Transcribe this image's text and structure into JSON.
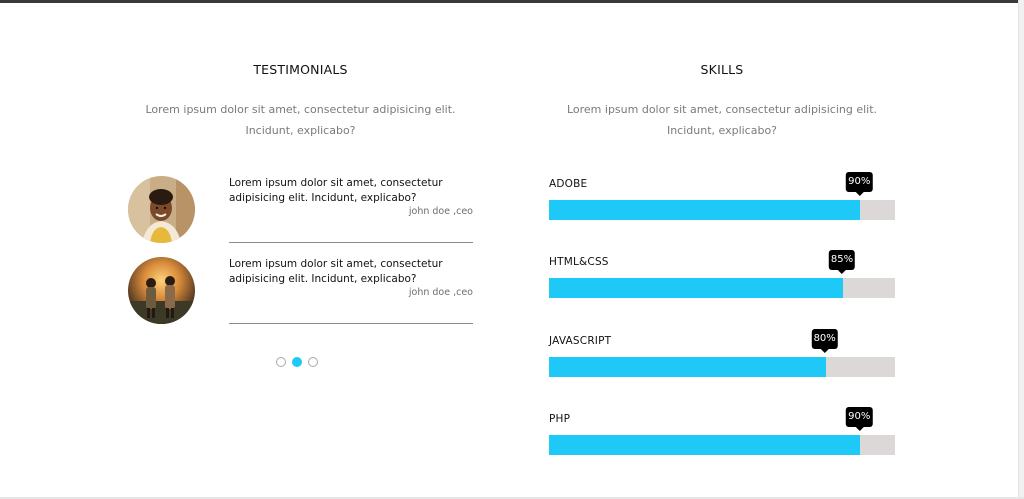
{
  "testimonials": {
    "title": "TESTIMONIALS",
    "subtitle": "Lorem ipsum dolor sit amet, consectetur adipisicing elit. Incidunt, explicabo?",
    "items": [
      {
        "quote": "Lorem ipsum dolor sit amet, consectetur adipisicing elit. Incidunt, explicabo?",
        "author": "john doe ,ceo"
      },
      {
        "quote": "Lorem ipsum dolor sit amet, consectetur adipisicing elit. Incidunt, explicabo?",
        "author": "john doe ,ceo"
      }
    ],
    "pagination": {
      "count": 3,
      "active_index": 1
    }
  },
  "skills": {
    "title": "SKILLS",
    "subtitle": "Lorem ipsum dolor sit amet, consectetur adipisicing elit. Incidunt, explicabo?",
    "items": [
      {
        "name": "ADOBE",
        "percent": 90,
        "label": "90%"
      },
      {
        "name": "HTML&CSS",
        "percent": 85,
        "label": "85%"
      },
      {
        "name": "JAVASCRIPT",
        "percent": 80,
        "label": "80%"
      },
      {
        "name": "PHP",
        "percent": 90,
        "label": "90%"
      }
    ]
  },
  "colors": {
    "bar_fill": "#1ec8f7",
    "bar_track": "#dcd8d8",
    "tooltip": "#000000",
    "dot_active": "#1ec8f7"
  }
}
